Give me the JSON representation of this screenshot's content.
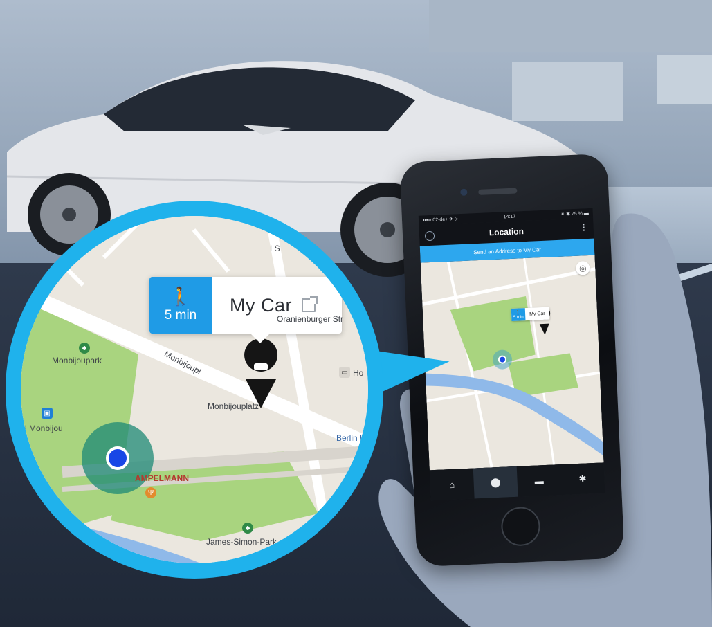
{
  "phone": {
    "status_left": "•••∞ 02-de+  ✈ ▷",
    "status_time": "14:17",
    "status_right": "⁕ ✱ 75 % ▬",
    "title": "Location",
    "send_address_bar": "Send an Address to My Car",
    "callout_time": "5 min",
    "callout_name": "My Car",
    "tabs": [
      {
        "icon": "home-icon",
        "glyph": "⌂"
      },
      {
        "icon": "location-pin-icon",
        "glyph": "⬤"
      },
      {
        "icon": "car-icon",
        "glyph": "▬"
      },
      {
        "icon": "gear-icon",
        "glyph": "✱"
      }
    ],
    "active_tab": "location-pin-icon"
  },
  "zoom": {
    "walk_time": "5 min",
    "car_name": "My Car",
    "street_top": "Oranienburger Str",
    "street_diag": "Monbijoupl",
    "labels": {
      "park": "Monbijoupark",
      "platz": "Monbijouplatz",
      "monbijou": "l Monbijou",
      "hotel": "Ho",
      "berlin": "Berlin H",
      "ampelmann": "AMPELMANN",
      "james_simon": "James-Simon-Park",
      "ls": "LS"
    }
  },
  "colors": {
    "accent": "#1fb2ec",
    "walk_box": "#1f9be6",
    "park_green": "#a9d47f",
    "river": "#8fb9e9",
    "user_dot": "#1947e6"
  }
}
